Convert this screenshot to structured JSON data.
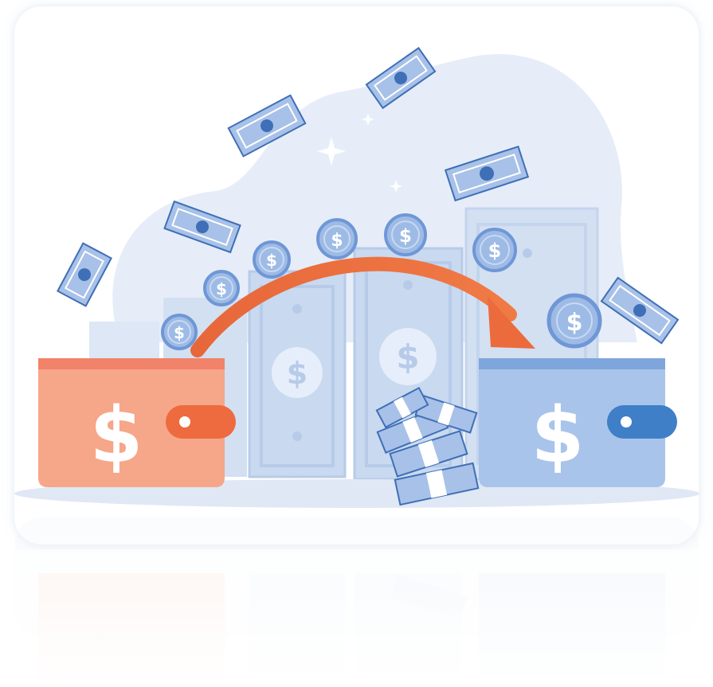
{
  "illustration": {
    "subject": "money-transfer-between-wallets",
    "symbol": "$",
    "colors": {
      "background": "#ffffff",
      "card": "#ffffff",
      "blob": "#e6edf8",
      "bill_light": "#d8e4f4",
      "bill_mid": "#aec4e6",
      "bill_dark": "#3f6fb6",
      "coin_fill": "#9ebbe6",
      "coin_ring": "#6f97d6",
      "coin_symbol": "#ffffff",
      "wallet_left": "#f6a689",
      "wallet_left_band": "#f0836a",
      "wallet_left_clasp": "#ee6a3f",
      "wallet_right": "#a9c4ea",
      "wallet_right_band": "#7ea6dc",
      "wallet_right_clasp": "#3f7fc8",
      "arrow": "#ec6b3c",
      "ground": "#dfe8f4"
    },
    "icons": [
      "wallet-icon",
      "coin-icon",
      "banknote-icon",
      "cash-stack-icon",
      "arrow-icon",
      "sparkle-icon"
    ]
  }
}
